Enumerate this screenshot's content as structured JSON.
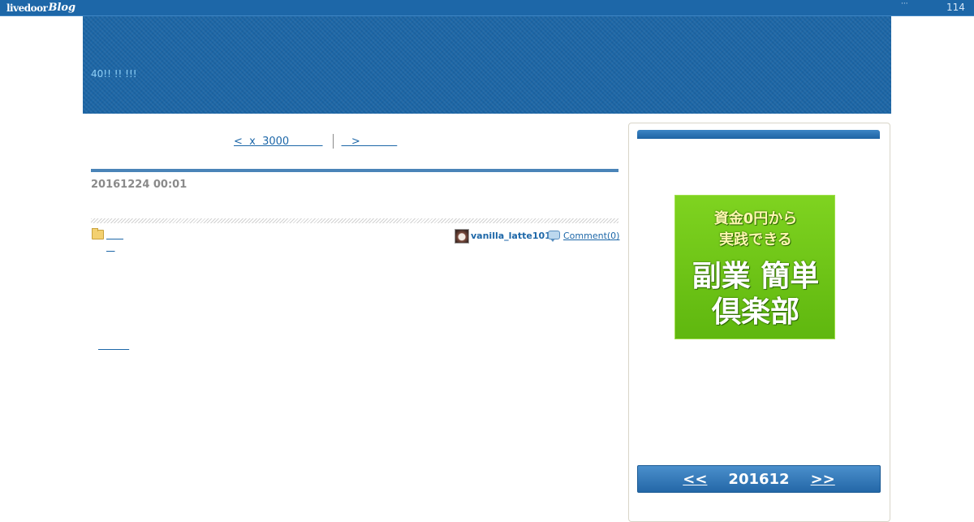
{
  "topbar": {
    "logo_text": "livedoor",
    "logo_blog": "Blog",
    "dots": "···",
    "count": "114"
  },
  "header": {
    "blog_title": "40!! !! !!!"
  },
  "nav": {
    "prev_label": "<  x  3000          ",
    "next_label": "   >           "
  },
  "post": {
    "date": "20161224 00:01",
    "category_link_1": "      ",
    "category_link_2": "   ",
    "author": "vanilla_latte101",
    "comment_label": "Comment(0)",
    "bottom_link": "          "
  },
  "sidebar": {
    "ad": {
      "line1": "資金0円から",
      "line2": "実践できる",
      "line3": "副業 簡単",
      "line4": "倶楽部"
    },
    "calendar": {
      "prev": "<<",
      "month": "201612",
      "next": ">>"
    }
  },
  "colors": {
    "brand_blue": "#1d67a8",
    "ad_green": "#6cc418"
  }
}
